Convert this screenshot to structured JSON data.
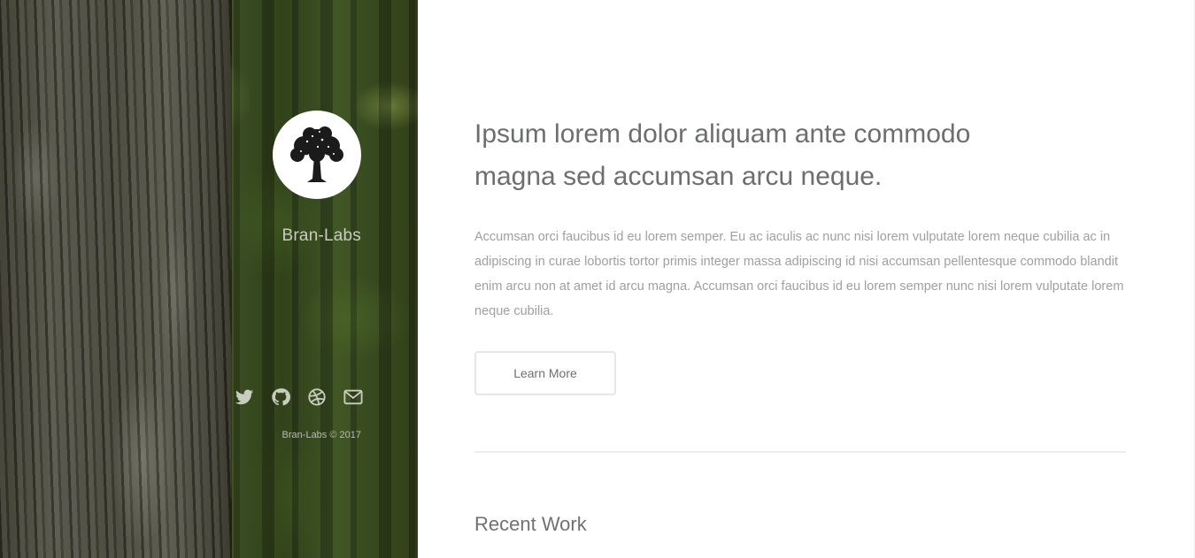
{
  "sidebar": {
    "brand_name": "Bran-Labs",
    "avatar_icon": "tree-icon",
    "social": [
      {
        "name": "twitter-icon"
      },
      {
        "name": "github-icon"
      },
      {
        "name": "dribbble-icon"
      },
      {
        "name": "envelope-icon"
      }
    ],
    "copyright": "Bran-Labs © 2017"
  },
  "main": {
    "headline_line1": "Ipsum lorem dolor aliquam ante commodo",
    "headline_line2": "magna sed accumsan arcu neque.",
    "body": "Accumsan orci faucibus id eu lorem semper. Eu ac iaculis ac nunc nisi lorem vulputate lorem neque cubilia ac in adipiscing in curae lobortis tortor primis integer massa adipiscing id nisi accumsan pellentesque commodo blandit enim arcu non at amet id arcu magna. Accumsan orci faucibus id eu lorem semper nunc nisi lorem vulputate lorem neque cubilia.",
    "learn_more_label": "Learn More",
    "recent_work_title": "Recent Work"
  },
  "colors": {
    "sidebar_text": "#c9cdbd",
    "headline": "#6d6e6e",
    "body_text": "#9ea0a2",
    "button_border": "#e6e7e8"
  }
}
